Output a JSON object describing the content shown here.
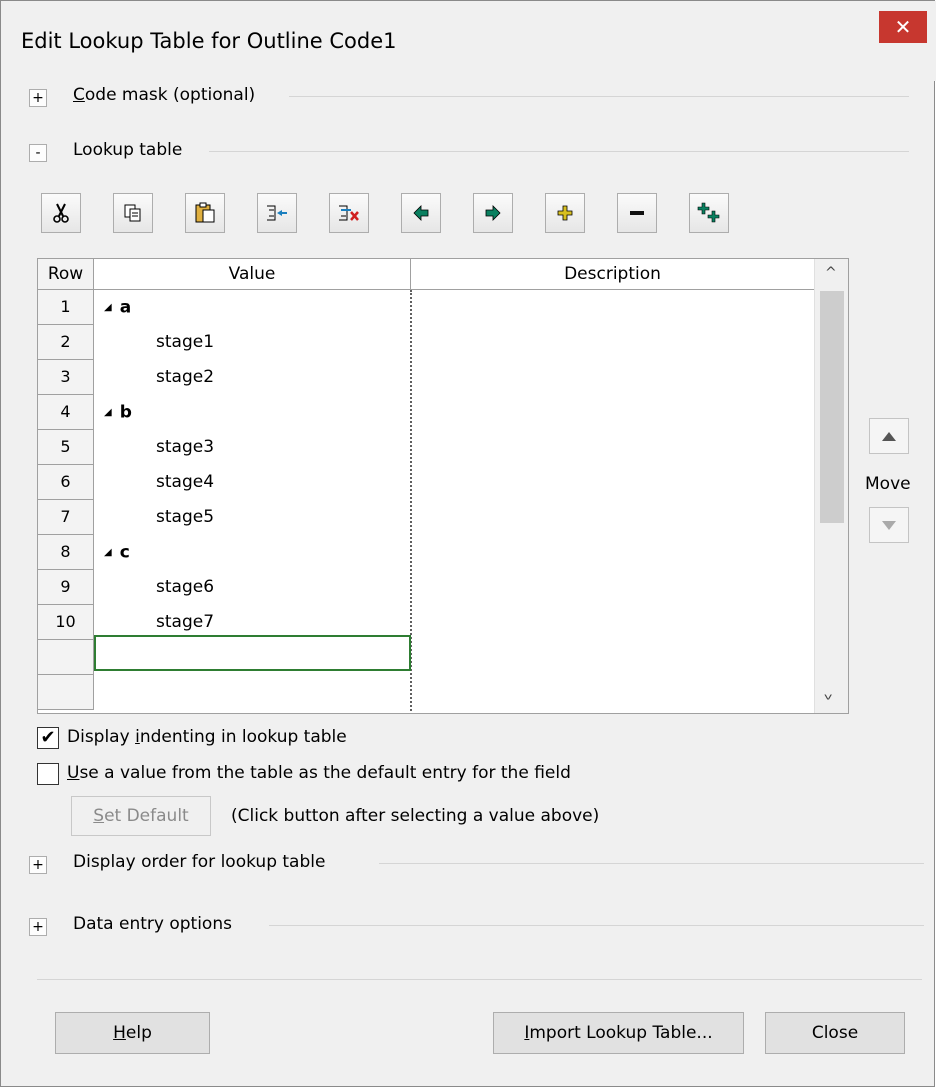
{
  "window": {
    "title": "Edit Lookup Table for Outline Code1",
    "close_glyph": "✕"
  },
  "sections": {
    "code_mask": {
      "label": "Code mask (optional)",
      "toggle": "+"
    },
    "lookup_table": {
      "label": "Lookup table",
      "toggle": "-"
    },
    "display_order": {
      "label": "Display order for lookup table",
      "toggle": "+"
    },
    "data_entry": {
      "label": "Data entry options",
      "toggle": "+"
    }
  },
  "toolbar": {
    "cut": "cut-icon",
    "copy": "copy-icon",
    "paste": "paste-icon",
    "insert_row": "insert-row-icon",
    "delete_row": "delete-row-icon",
    "outdent": "outdent-icon",
    "indent": "indent-icon",
    "expand": "expand-icon",
    "collapse": "collapse-icon",
    "expand_all": "expand-all-icon"
  },
  "table": {
    "columns": [
      "Row",
      "Value",
      "Description"
    ],
    "rows": [
      {
        "num": "1",
        "value": "a",
        "level": 0,
        "expander": "◢"
      },
      {
        "num": "2",
        "value": "stage1",
        "level": 1,
        "expander": ""
      },
      {
        "num": "3",
        "value": "stage2",
        "level": 1,
        "expander": ""
      },
      {
        "num": "4",
        "value": "b",
        "level": 0,
        "expander": "◢"
      },
      {
        "num": "5",
        "value": "stage3",
        "level": 1,
        "expander": ""
      },
      {
        "num": "6",
        "value": "stage4",
        "level": 1,
        "expander": ""
      },
      {
        "num": "7",
        "value": "stage5",
        "level": 1,
        "expander": ""
      },
      {
        "num": "8",
        "value": "c",
        "level": 0,
        "expander": "◢"
      },
      {
        "num": "9",
        "value": "stage6",
        "level": 1,
        "expander": ""
      },
      {
        "num": "10",
        "value": "stage7",
        "level": 1,
        "expander": ""
      }
    ]
  },
  "move": {
    "label": "Move"
  },
  "options": {
    "display_indenting": {
      "label_pre": "Display ",
      "label_key": "i",
      "label_post": "ndenting in lookup table",
      "checked": true
    },
    "use_default": {
      "label_pre": "",
      "label_key": "U",
      "label_post": "se a value from the table as the default entry for the field",
      "checked": false
    },
    "set_default_button": {
      "label_key": "S",
      "label_post": "et Default"
    },
    "hint": "(Click button after selecting a value above)"
  },
  "footer": {
    "help": {
      "key": "H",
      "rest": "elp"
    },
    "import": {
      "key": "I",
      "rest": "mport Lookup Table..."
    },
    "close": "Close"
  },
  "colors": {
    "accent_green": "#2e7d32",
    "close_red": "#c7372f"
  }
}
